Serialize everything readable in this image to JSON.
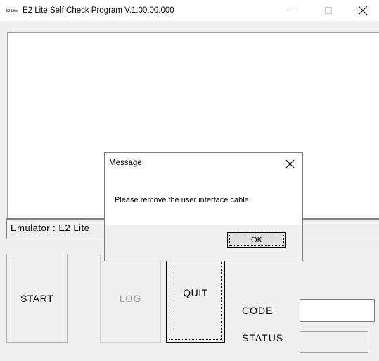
{
  "window": {
    "icon_text": "E2 Lite",
    "title": "E2 Lite Self Check Program V.1.00.00.000",
    "minimize_icon": "minimize-icon",
    "maximize_icon": "maximize-icon",
    "close_icon": "close-icon"
  },
  "log_area": {
    "text": ""
  },
  "emulator": {
    "label": "Emulator : E2 Lite"
  },
  "buttons": {
    "start": "START",
    "log": "LOG",
    "quit": "QUIT"
  },
  "fields": {
    "code_label": "CODE",
    "code_value": "",
    "status_label": "STATUS",
    "status_value": ""
  },
  "dialog": {
    "title": "Message",
    "message": "Please remove the user interface cable.",
    "ok": "OK",
    "close_icon": "close-icon"
  },
  "colors": {
    "window_bg": "#f0f0f0",
    "titlebar_bg": "#ffffff",
    "disabled_text": "#a0a0a0"
  }
}
